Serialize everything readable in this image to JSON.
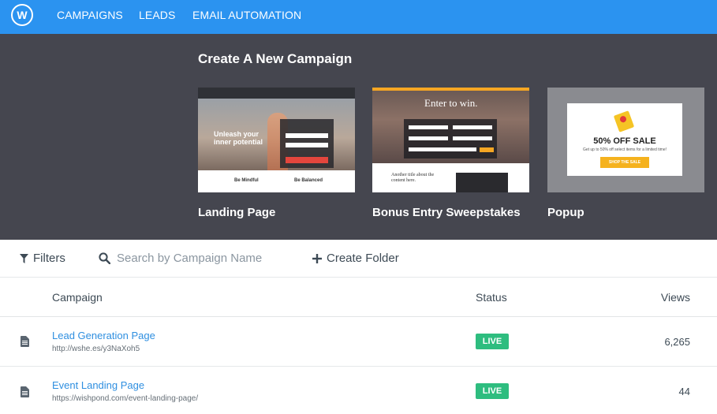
{
  "nav": {
    "logo_letter": "W",
    "items": [
      {
        "label": "CAMPAIGNS"
      },
      {
        "label": "LEADS"
      },
      {
        "label": "EMAIL AUTOMATION"
      }
    ]
  },
  "hero": {
    "title": "Create A New Campaign",
    "cards": [
      {
        "label": "Landing Page",
        "thumb_headline": "Unleash your inner potential",
        "thumb_col1": "Be Mindful",
        "thumb_col2": "Be Balanced"
      },
      {
        "label": "Bonus Entry Sweepstakes",
        "thumb_headline": "Enter to win.",
        "thumb_subtext": "Another title about the content here."
      },
      {
        "label": "Popup",
        "thumb_headline": "50% OFF SALE",
        "thumb_subtext": "Get up to 50% off select items for a limited time!",
        "thumb_button": "SHOP THE SALE"
      }
    ]
  },
  "toolbar": {
    "filters_label": "Filters",
    "search_placeholder": "Search by Campaign Name",
    "create_folder_label": "Create Folder"
  },
  "table": {
    "columns": {
      "campaign": "Campaign",
      "status": "Status",
      "views": "Views"
    },
    "rows": [
      {
        "name": "Lead Generation Page",
        "url": "http://wshe.es/y3NaXoh5",
        "status": "LIVE",
        "views": "6,265"
      },
      {
        "name": "Event Landing Page",
        "url": "https://wishpond.com/event-landing-page/",
        "status": "LIVE",
        "views": "44"
      }
    ]
  },
  "colors": {
    "nav_bg": "#2b93f0",
    "hero_bg": "#45464f",
    "link": "#2f8fe0",
    "live_badge": "#2ebd7f"
  },
  "icons": {
    "logo": "wishpond-logo-icon",
    "filter": "filter-icon",
    "search": "search-icon",
    "create_folder": "plus-icon",
    "row": "document-icon"
  }
}
